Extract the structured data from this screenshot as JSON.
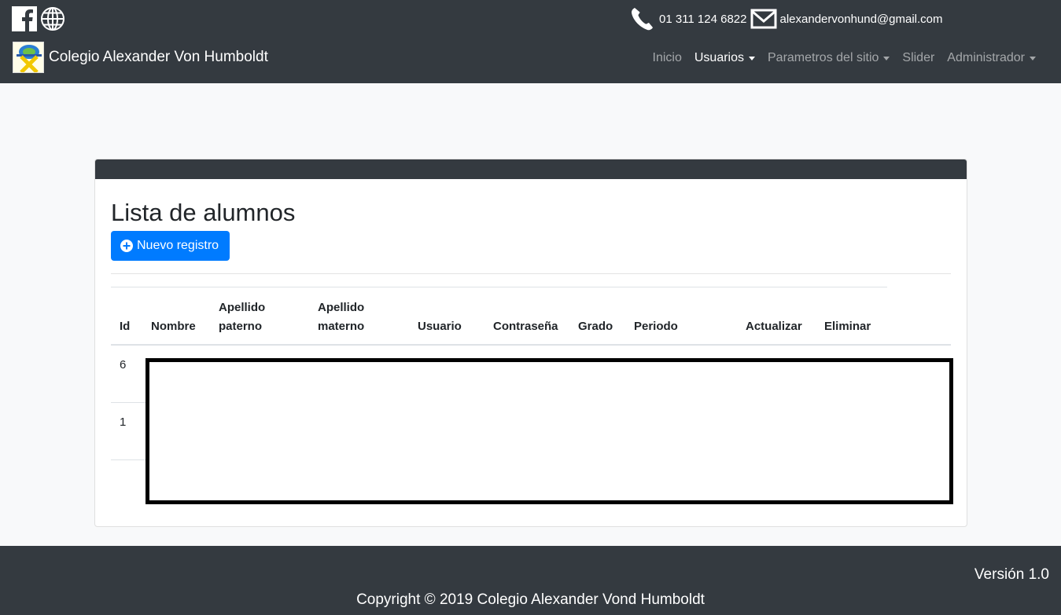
{
  "header": {
    "social": {
      "facebook_icon": "facebook-icon",
      "web_icon": "globe-icon"
    },
    "contact": {
      "phone_icon": "phone-icon",
      "phone": "01 311 124 6822",
      "mail_icon": "mail-icon",
      "email": "alexandervonhund@gmail.com"
    },
    "brand": {
      "title": "Colegio Alexander Von Humboldt"
    },
    "nav": [
      {
        "label": "Inicio",
        "dropdown": false,
        "active": false
      },
      {
        "label": "Usuarios",
        "dropdown": true,
        "active": true
      },
      {
        "label": "Parametros del sitio",
        "dropdown": true,
        "active": false
      },
      {
        "label": "Slider",
        "dropdown": false,
        "active": false
      },
      {
        "label": "Administrador",
        "dropdown": true,
        "active": false
      }
    ]
  },
  "main": {
    "title": "Lista de alumnos",
    "new_button": {
      "label": "Nuevo registro",
      "icon": "plus-circle-icon"
    },
    "table": {
      "headers": {
        "id": "Id",
        "nombre": "Nombre",
        "apellido_paterno_1": "Apellido",
        "apellido_paterno_2": "paterno",
        "apellido_materno_1": "Apellido",
        "apellido_materno_2": "materno",
        "usuario": "Usuario",
        "contrasena": "Contraseña",
        "grado": "Grado",
        "periodo": "Periodo",
        "actualizar": "Actualizar",
        "eliminar": "Eliminar"
      },
      "rows": [
        {
          "id": "6"
        },
        {
          "id": "1"
        }
      ]
    }
  },
  "footer": {
    "version": "Versión 1.0",
    "copyright": "Copyright © 2019 Colegio Alexander Vond Humboldt"
  },
  "colors": {
    "dark": "#343a40",
    "primary": "#007bff",
    "background": "#f8f9fa"
  }
}
